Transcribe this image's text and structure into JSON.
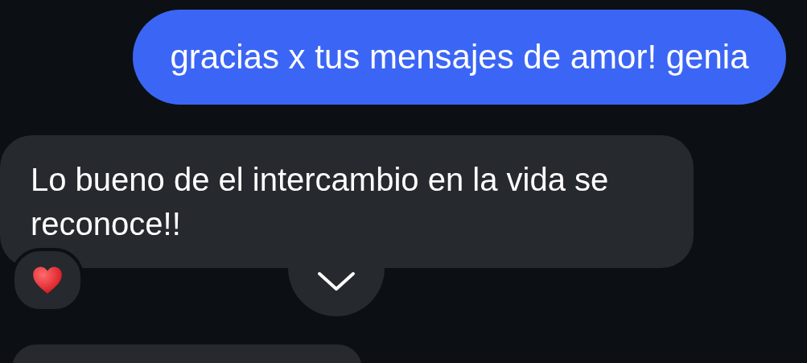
{
  "messages": [
    {
      "kind": "sent",
      "text": "gracias x tus mensajes de amor! genia"
    },
    {
      "kind": "received",
      "text": "Lo bueno de el intercambio en la vida se reconoce!!",
      "reaction": true
    },
    {
      "kind": "received_partial"
    }
  ]
}
